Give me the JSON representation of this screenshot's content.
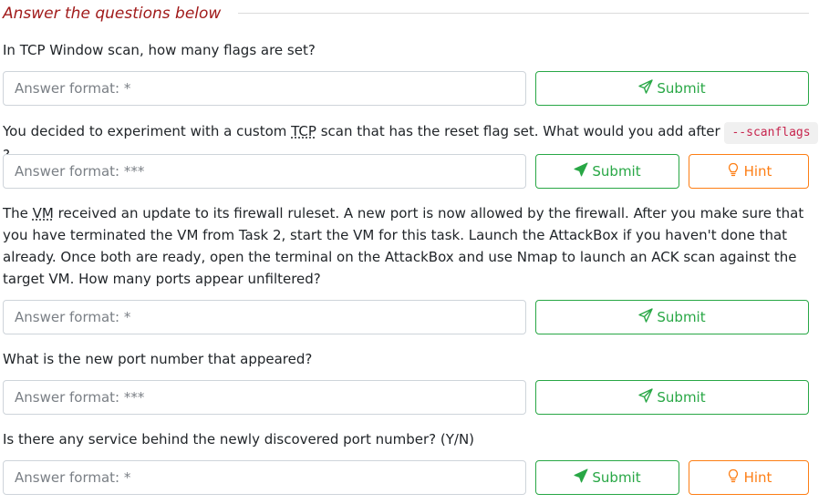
{
  "header": {
    "title": "Answer the questions below"
  },
  "questions": [
    {
      "text": "In TCP Window scan, how many flags are set?",
      "placeholder": "Answer format: *",
      "submit_label": "Submit"
    },
    {
      "text_before": "You decided to experiment with a custom ",
      "abbr": "TCP",
      "text_middle": " scan that has the reset flag set. What would you add after ",
      "code": "--scanflags",
      "text_after": " ?",
      "placeholder": "Answer format: ***",
      "submit_label": "Submit",
      "hint_label": "Hint"
    },
    {
      "text_before": "The ",
      "abbr": "VM",
      "text_after": " received an update to its firewall ruleset. A new port is now allowed by the firewall. After you make sure that you have terminated the VM from Task 2, start the VM for this task. Launch the AttackBox if you haven't done that already. Once both are ready, open the terminal on the AttackBox and use Nmap to launch an ACK scan against the target VM. How many ports appear unfiltered?",
      "placeholder": "Answer format: *",
      "submit_label": "Submit"
    },
    {
      "text": "What is the new port number that appeared?",
      "placeholder": "Answer format: ***",
      "submit_label": "Submit"
    },
    {
      "text": "Is there any service behind the newly discovered port number? (Y/N)",
      "placeholder": "Answer format: *",
      "submit_label": "Submit",
      "hint_label": "Hint"
    }
  ],
  "icons": {
    "submit": "paper-plane-icon",
    "hint": "lightbulb-icon"
  },
  "colors": {
    "title": "#a11b1b",
    "submit": "#28a745",
    "hint": "#fd7e14",
    "code": "#c7254e"
  }
}
